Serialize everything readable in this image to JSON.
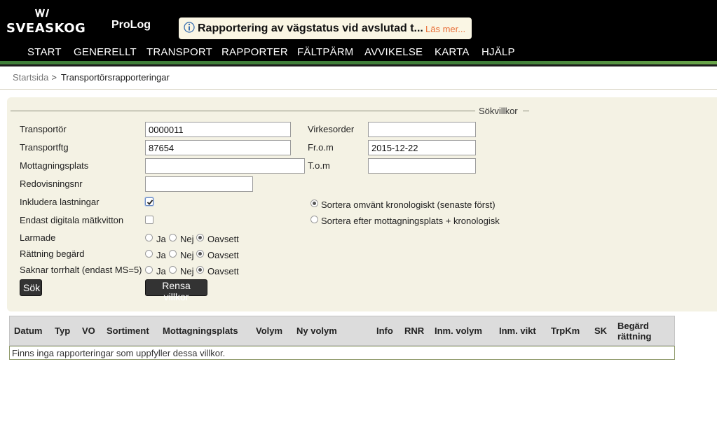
{
  "header": {
    "logo_text": "SVEASKOG",
    "app_name": "ProLog",
    "notice": {
      "title": "Rapportering av vägstatus vid avslutad t...",
      "more_link": "Läs mer..."
    }
  },
  "nav": [
    "START",
    "GENERELLT",
    "TRANSPORT",
    "RAPPORTER",
    "FÄLTPÄRM",
    "AVVIKELSE",
    "KARTA",
    "HJÄLP"
  ],
  "breadcrumb": {
    "home": "Startsida",
    "separator": ">",
    "current": "Transportörsrapporteringar"
  },
  "search": {
    "legend": "Sökvillkor",
    "fields": {
      "transportor": {
        "label": "Transportör",
        "value": "0000011"
      },
      "transportftg": {
        "label": "Transportftg",
        "value": "87654"
      },
      "mottagningsplats": {
        "label": "Mottagningsplats",
        "value": ""
      },
      "redovisningsnr": {
        "label": "Redovisningsnr",
        "value": ""
      },
      "virkesorder": {
        "label": "Virkesorder",
        "value": ""
      },
      "from": {
        "label": "Fr.o.m",
        "value": "2015-12-22"
      },
      "tom": {
        "label": "T.o.m",
        "value": ""
      }
    },
    "checkboxes": {
      "inkludera_lastningar": {
        "label": "Inkludera lastningar",
        "checked": true
      },
      "endast_digitala": {
        "label": "Endast digitala mätkvitton",
        "checked": false
      }
    },
    "sort_options": [
      {
        "label": "Sortera omvänt kronologiskt (senaste först)",
        "selected": true
      },
      {
        "label": "Sortera efter mottagningsplats + kronologisk",
        "selected": false
      }
    ],
    "radio_groups": [
      {
        "label": "Larmade",
        "options": [
          "Ja",
          "Nej",
          "Oavsett"
        ],
        "selected": "Oavsett"
      },
      {
        "label": "Rättning begärd",
        "options": [
          "Ja",
          "Nej",
          "Oavsett"
        ],
        "selected": "Oavsett"
      },
      {
        "label": "Saknar torrhalt (endast MS=5)",
        "options": [
          "Ja",
          "Nej",
          "Oavsett"
        ],
        "selected": "Oavsett"
      }
    ],
    "buttons": {
      "search": "Sök",
      "clear": "Rensa villkor"
    }
  },
  "table": {
    "columns": [
      "Datum",
      "Typ",
      "VO",
      "Sortiment",
      "Mottagningsplats",
      "Volym",
      "Ny volym",
      "Info",
      "RNR",
      "Inm. volym",
      "Inm. vikt",
      "TrpKm",
      "SK",
      "Begärd",
      "rättning"
    ],
    "empty_message": "Finns inga rapporteringar som uppfyller dessa villkor."
  }
}
